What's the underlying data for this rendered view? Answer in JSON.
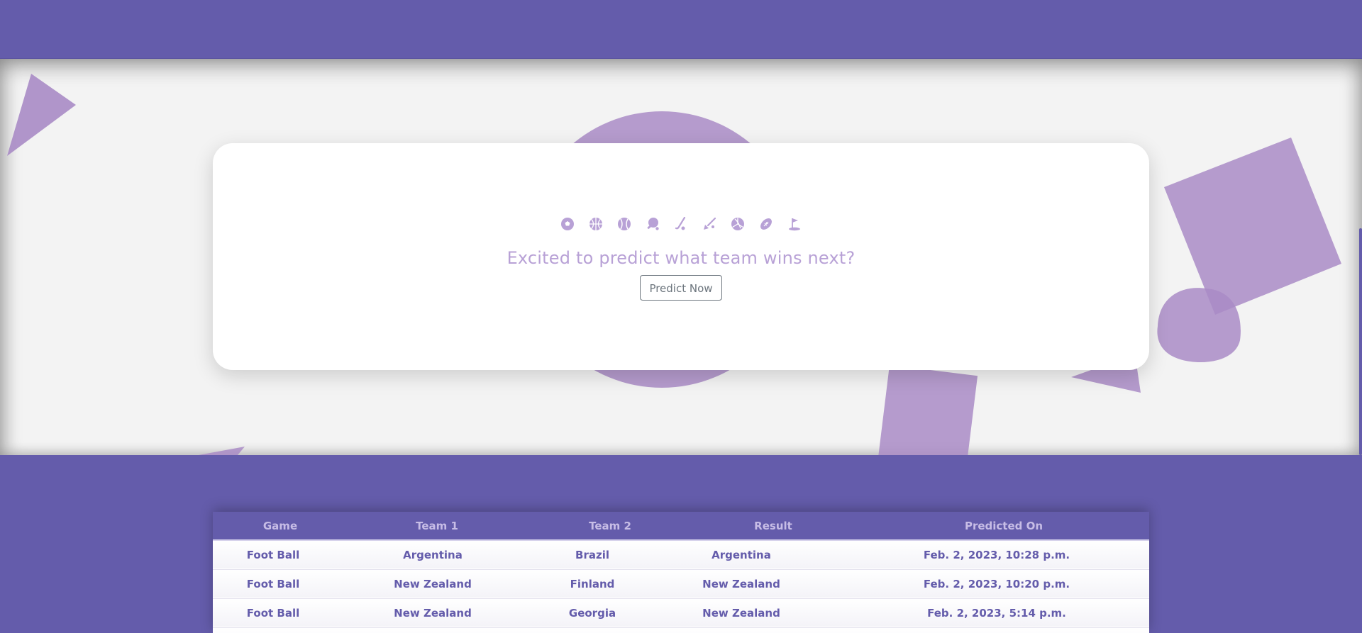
{
  "hero": {
    "tagline": "Excited to predict what team wins next?",
    "cta_label": "Predict Now",
    "sport_icons": [
      "soccer-ball-icon",
      "basketball-icon",
      "baseball-icon",
      "table-tennis-icon",
      "hockey-icon",
      "badminton-icon",
      "volleyball-icon",
      "rugby-ball-icon",
      "golf-icon"
    ]
  },
  "table": {
    "headers": [
      "Game",
      "Team 1",
      "Team 2",
      "Result",
      "Predicted On"
    ],
    "rows": [
      [
        "Foot Ball",
        "Argentina",
        "Brazil",
        "Argentina",
        "Feb. 2, 2023, 10:28 p.m."
      ],
      [
        "Foot Ball",
        "New Zealand",
        "Finland",
        "New Zealand",
        "Feb. 2, 2023, 10:20 p.m."
      ],
      [
        "Foot Ball",
        "New Zealand",
        "Georgia",
        "New Zealand",
        "Feb. 2, 2023, 5:14 p.m."
      ]
    ]
  },
  "colors": {
    "brand": "#645cab",
    "accent": "#b8a1d6",
    "background": "#f3f3f3",
    "card": "#ffffff"
  }
}
